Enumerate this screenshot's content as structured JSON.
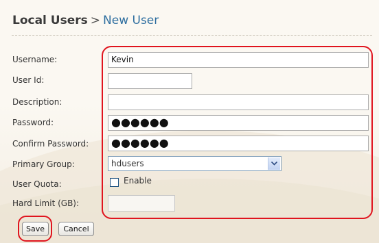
{
  "breadcrumb": {
    "root": "Local Users",
    "separator": ">",
    "current": "New User"
  },
  "form": {
    "username": {
      "label": "Username:",
      "value": "Kevin"
    },
    "user_id": {
      "label": "User Id:",
      "value": ""
    },
    "description": {
      "label": "Description:",
      "value": ""
    },
    "password": {
      "label": "Password:",
      "value": "●●●●●●"
    },
    "confirm_password": {
      "label": "Confirm Password:",
      "value": "●●●●●●"
    },
    "primary_group": {
      "label": "Primary Group:",
      "value": "hdusers"
    },
    "user_quota": {
      "label": "User Quota:",
      "checkbox_label": "Enable",
      "checked": false
    },
    "hard_limit": {
      "label": "Hard Limit (GB):",
      "value": ""
    }
  },
  "buttons": {
    "save": "Save",
    "cancel": "Cancel"
  },
  "colors": {
    "highlight": "#e0141e",
    "title_current": "#2f6fa0"
  }
}
